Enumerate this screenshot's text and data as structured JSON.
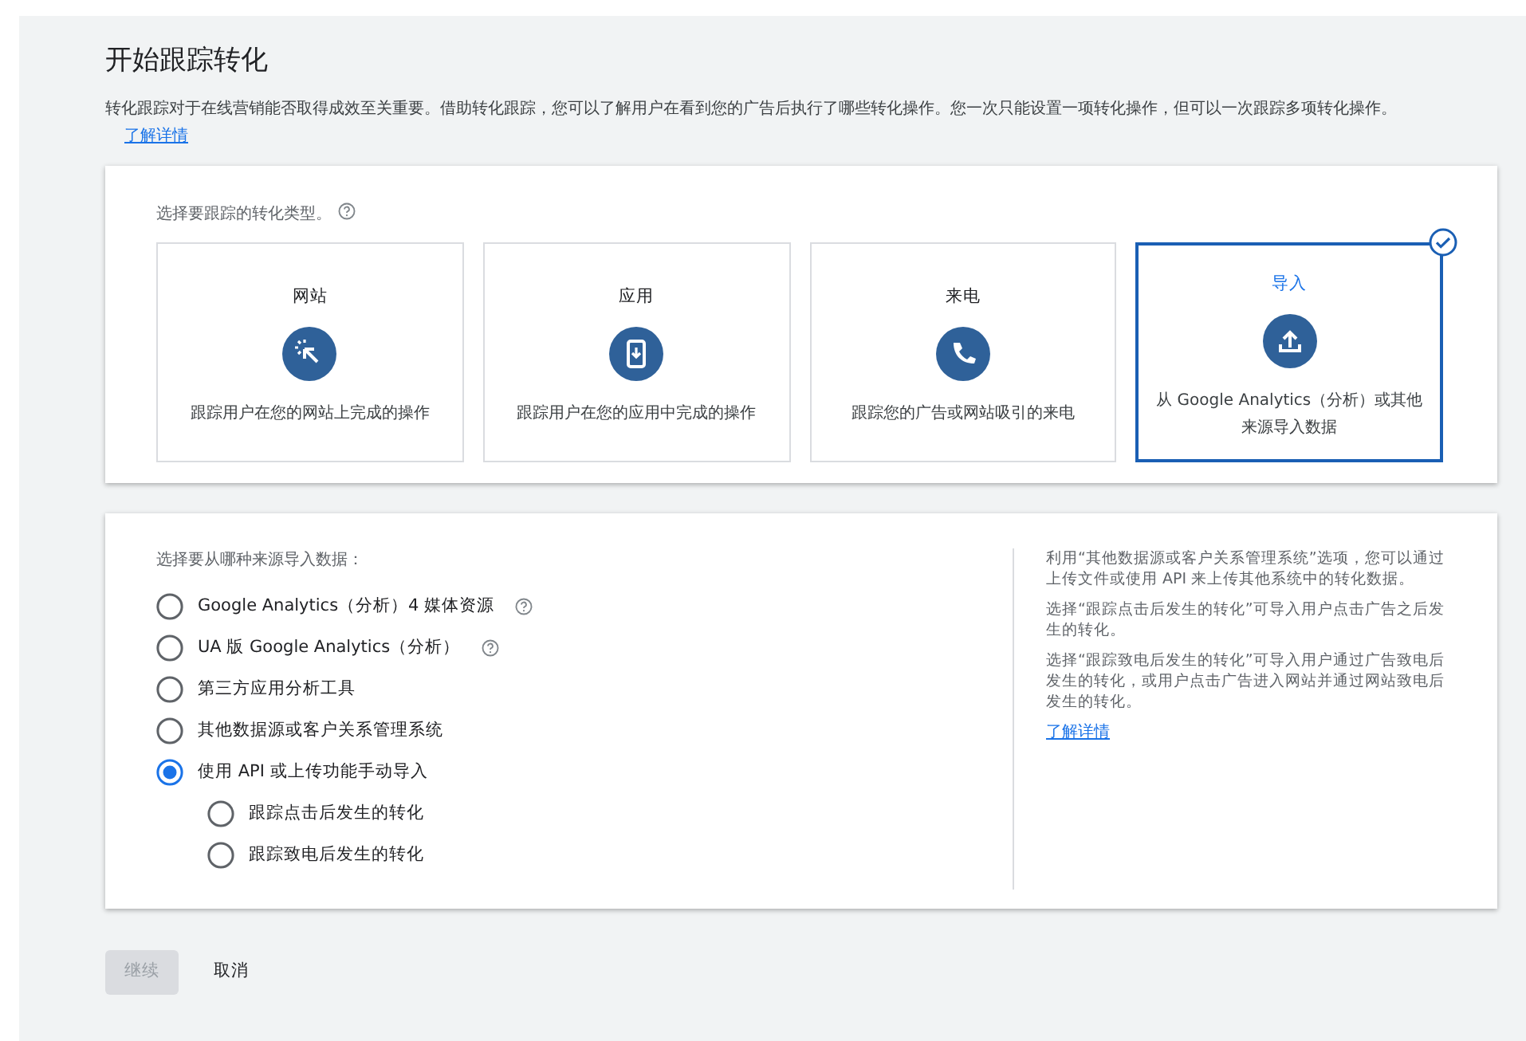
{
  "title": "开始跟踪转化",
  "intro": {
    "text": "转化跟踪对于在线营销能否取得成效至关重要。借助转化跟踪，您可以了解用户在看到您的广告后执行了哪些转化操作。您一次只能设置一项转化操作，但可以一次跟踪多项转化操作。",
    "link": "了解详情"
  },
  "type_section": {
    "label": "选择要跟踪的转化类型。",
    "help": true,
    "options": [
      {
        "title": "网站",
        "description": "跟踪用户在您的网站上完成的操作",
        "selected": false
      },
      {
        "title": "应用",
        "description": "跟踪用户在您的应用中完成的操作",
        "selected": false
      },
      {
        "title": "来电",
        "description": "跟踪您的广告或网站吸引的来电",
        "selected": false
      },
      {
        "title": "导入",
        "description": "从 Google Analytics（分析）或其他来源导入数据",
        "selected": true
      }
    ]
  },
  "source_section": {
    "label": "选择要从哪种来源导入数据：",
    "options": [
      {
        "label": "Google Analytics（分析）4 媒体资源",
        "help": true,
        "selected": false
      },
      {
        "label": "UA 版 Google Analytics（分析）",
        "help": true,
        "selected": false
      },
      {
        "label": "第三方应用分析工具",
        "selected": false
      },
      {
        "label": "其他数据源或客户关系管理系统",
        "selected": false
      },
      {
        "label": "使用 API 或上传功能手动导入",
        "selected": true,
        "children": [
          {
            "label": "跟踪点击后发生的转化",
            "selected": false
          },
          {
            "label": "跟踪致电后发生的转化",
            "selected": false
          }
        ]
      }
    ],
    "help_texts": [
      "利用“其他数据源或客户关系管理系统”选项，您可以通过上传文件或使用 API 来上传其他系统中的转化数据。",
      "选择“跟踪点击后发生的转化”可导入用户点击广告之后发生的转化。",
      "选择“跟踪致电后发生的转化”可导入用户通过广告致电后发生的转化，或用户点击广告进入网站并通过网站致电后发生的转化。"
    ],
    "link": "了解详情"
  },
  "buttons": [
    {
      "label": "继续",
      "kind": "primary",
      "disabled": true
    },
    {
      "label": "取消",
      "kind": "text",
      "disabled": false
    }
  ]
}
